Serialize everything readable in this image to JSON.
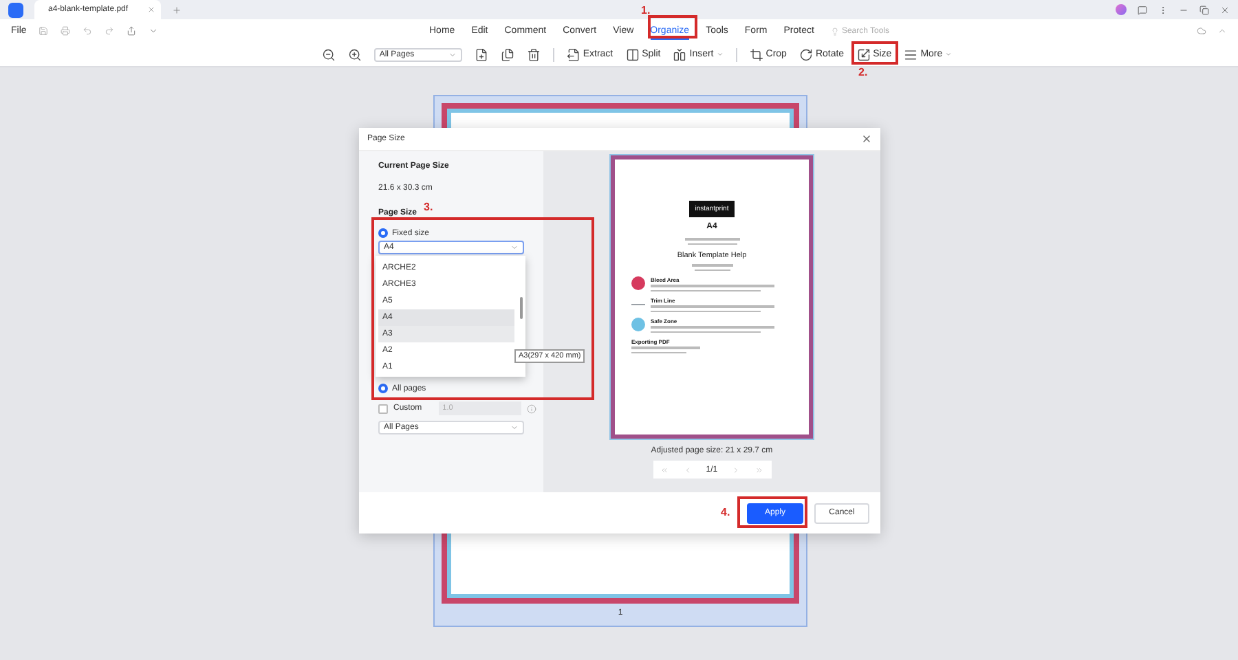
{
  "tab": {
    "title": "a4-blank-template.pdf"
  },
  "menu": {
    "file": "File",
    "items": [
      {
        "label": "Home",
        "selected": false
      },
      {
        "label": "Edit",
        "selected": false
      },
      {
        "label": "Comment",
        "selected": false
      },
      {
        "label": "Convert",
        "selected": false
      },
      {
        "label": "View",
        "selected": false
      },
      {
        "label": "Organize",
        "selected": true
      },
      {
        "label": "Tools",
        "selected": false
      },
      {
        "label": "Form",
        "selected": false
      },
      {
        "label": "Protect",
        "selected": false
      }
    ],
    "search_placeholder": "Search Tools"
  },
  "toolbar": [
    {
      "kind": "zoom-out"
    },
    {
      "kind": "zoom-in"
    },
    {
      "kind": "select",
      "label": "All Pages"
    },
    {
      "kind": "insert-page"
    },
    {
      "kind": "replace-page"
    },
    {
      "kind": "delete"
    },
    {
      "kind": "divider"
    },
    {
      "kind": "extract",
      "label": "Extract"
    },
    {
      "kind": "split",
      "label": "Split"
    },
    {
      "kind": "insert",
      "label": "Insert",
      "menu": true
    },
    {
      "kind": "divider"
    },
    {
      "kind": "crop",
      "label": "Crop"
    },
    {
      "kind": "rotate",
      "label": "Rotate"
    },
    {
      "kind": "size",
      "label": "Size"
    },
    {
      "kind": "more",
      "label": "More",
      "menu": true
    }
  ],
  "dialog": {
    "title": "Page Size",
    "current_label": "Current Page Size",
    "current_value": "21.6 x 30.3 cm",
    "size_label": "Page Size",
    "fixed": {
      "label": "Fixed size",
      "selected": true,
      "value": "A4",
      "expanded": true,
      "tooltip": "A3(297 x 420 mm)",
      "options": [
        {
          "label": "ARCHE2",
          "selected": false,
          "hovered": false
        },
        {
          "label": "ARCHE3",
          "selected": false,
          "hovered": false
        },
        {
          "label": "A5",
          "selected": false,
          "hovered": false
        },
        {
          "label": "A4",
          "selected": true,
          "hovered": false
        },
        {
          "label": "A3",
          "selected": false,
          "hovered": true
        },
        {
          "label": "A2",
          "selected": false,
          "hovered": false
        },
        {
          "label": "A1",
          "selected": false,
          "hovered": false
        }
      ]
    },
    "all_pages": {
      "label": "All pages",
      "selected": true
    },
    "custom": {
      "label": "Custom",
      "checked": false,
      "placeholder": "1.0"
    },
    "range": {
      "value": "All Pages"
    },
    "preview": {
      "logo": "instantprint",
      "size": "A4",
      "heading": "Blank Template Help",
      "sections": [
        {
          "title": "Bleed Area",
          "kind": "dot",
          "color": "#d63a5e"
        },
        {
          "title": "Trim Line",
          "kind": "line",
          "color": "#9aa0a6"
        },
        {
          "title": "Safe Zone",
          "kind": "dot",
          "color": "#6ec1e4"
        },
        {
          "title": "Exporting PDF",
          "kind": "none"
        }
      ]
    },
    "caption": "Adjusted page size: 21 x 29.7 cm",
    "pager": "1/1",
    "buttons": [
      {
        "label": "Apply",
        "kind": "primary"
      },
      {
        "label": "Cancel",
        "kind": "secondary"
      }
    ]
  },
  "page_number": "1",
  "annotations": [
    {
      "label": "1."
    },
    {
      "label": "2."
    },
    {
      "label": "3."
    },
    {
      "label": "4."
    }
  ]
}
